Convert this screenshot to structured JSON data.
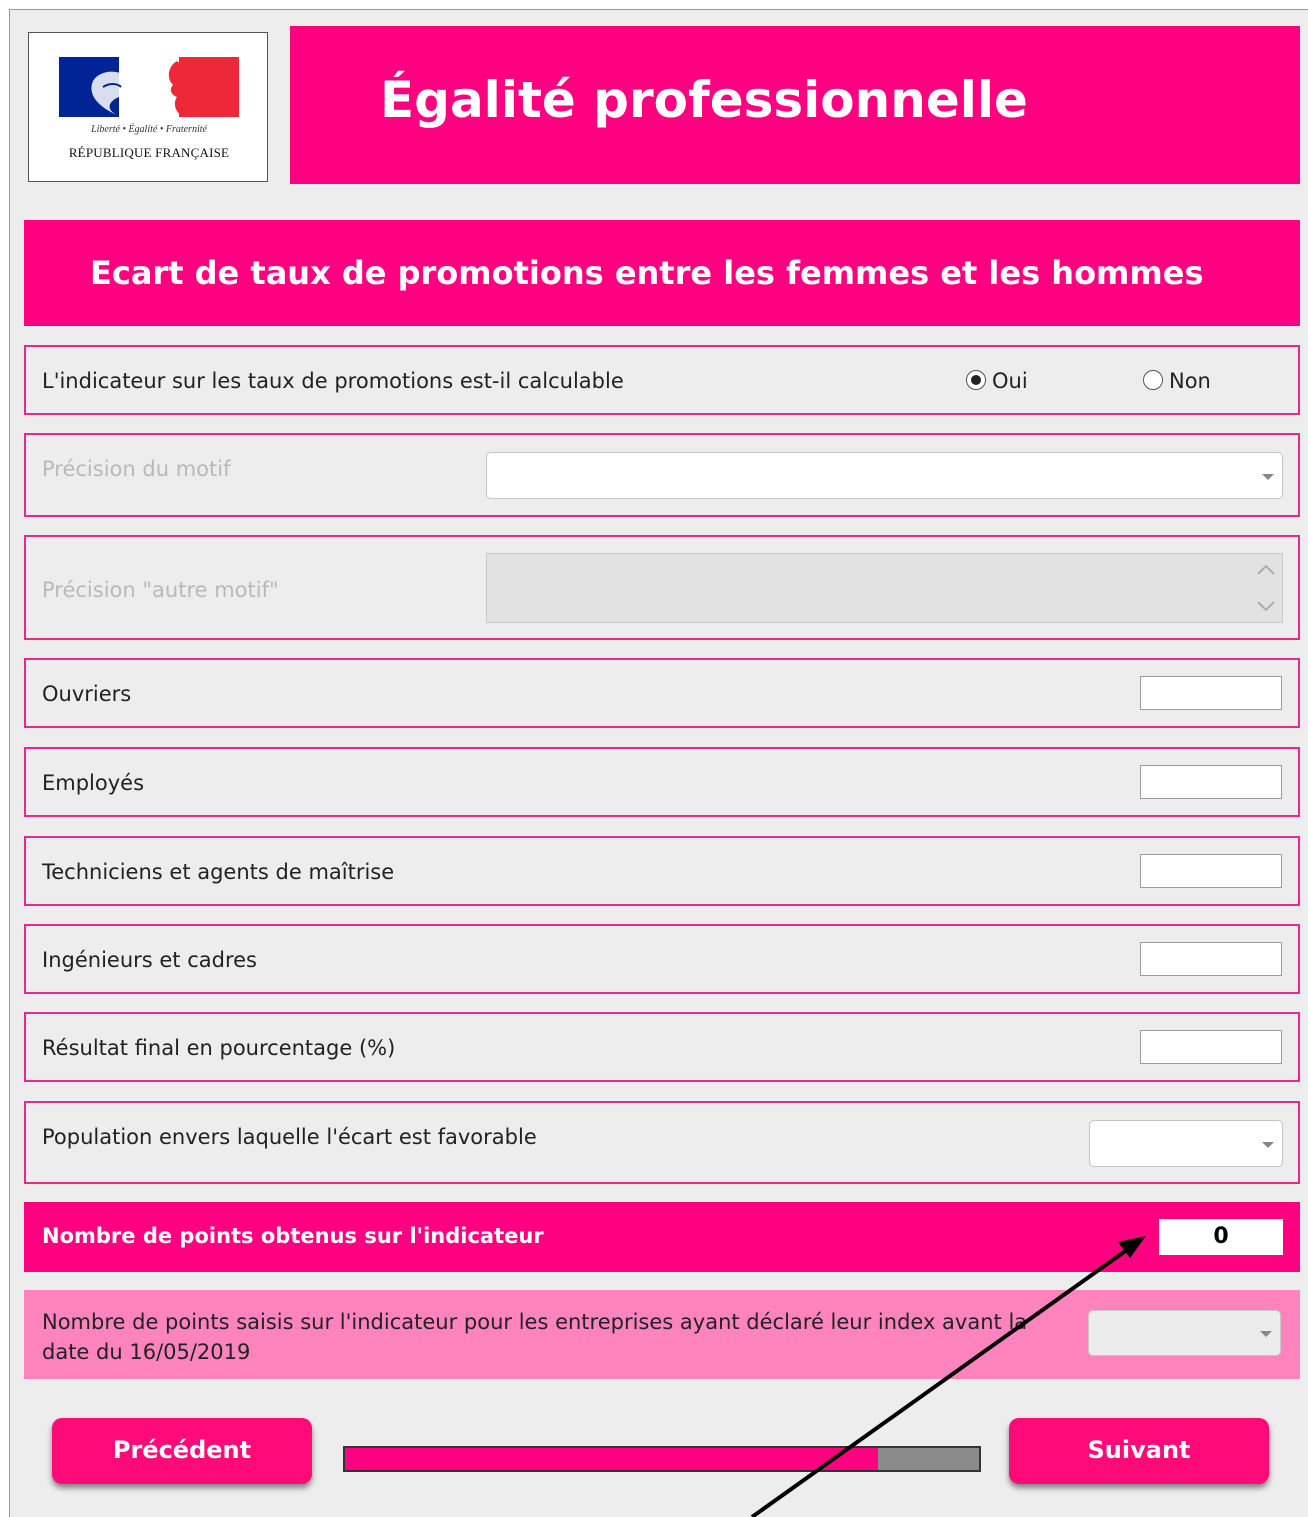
{
  "header": {
    "logo": {
      "motto": "Liberté • Égalité • Fraternité",
      "republic": "RÉPUBLIQUE FRANÇAISE",
      "colors": [
        "#002395",
        "#ffffff",
        "#ed2939"
      ]
    },
    "title": "Égalité professionnelle"
  },
  "section_title": "Ecart de taux de promotions entre les femmes et les hommes",
  "calculable": {
    "label": "L'indicateur sur les taux de promotions est-il calculable",
    "options": [
      {
        "label": "Oui",
        "selected": true
      },
      {
        "label": "Non",
        "selected": false
      }
    ]
  },
  "motif": {
    "label": "Précision du motif",
    "selected_value": ""
  },
  "autre_motif": {
    "label": "Précision \"autre motif\"",
    "value": ""
  },
  "categories": [
    {
      "label": "Ouvriers",
      "value": ""
    },
    {
      "label": "Employés",
      "value": ""
    },
    {
      "label": "Techniciens et agents de maîtrise",
      "value": ""
    },
    {
      "label": "Ingénieurs et cadres",
      "value": ""
    },
    {
      "label": "Résultat final en pourcentage (%)",
      "value": ""
    }
  ],
  "population": {
    "label": "Population envers laquelle l'écart est favorable",
    "selected_value": ""
  },
  "points": {
    "label": "Nombre de points obtenus sur l'indicateur",
    "value": "0"
  },
  "points_saisis": {
    "label": "Nombre de points saisis sur l'indicateur pour les entreprises ayant déclaré leur index avant la date du 16/05/2019",
    "selected_value": ""
  },
  "navigation": {
    "previous_label": "Précédent",
    "next_label": "Suivant",
    "progress_fraction": 0.84
  },
  "colors": {
    "brand_pink": "#ff0080",
    "light_pink": "#ff83bd",
    "row_border": "#e8288a",
    "background": "#ededed"
  }
}
